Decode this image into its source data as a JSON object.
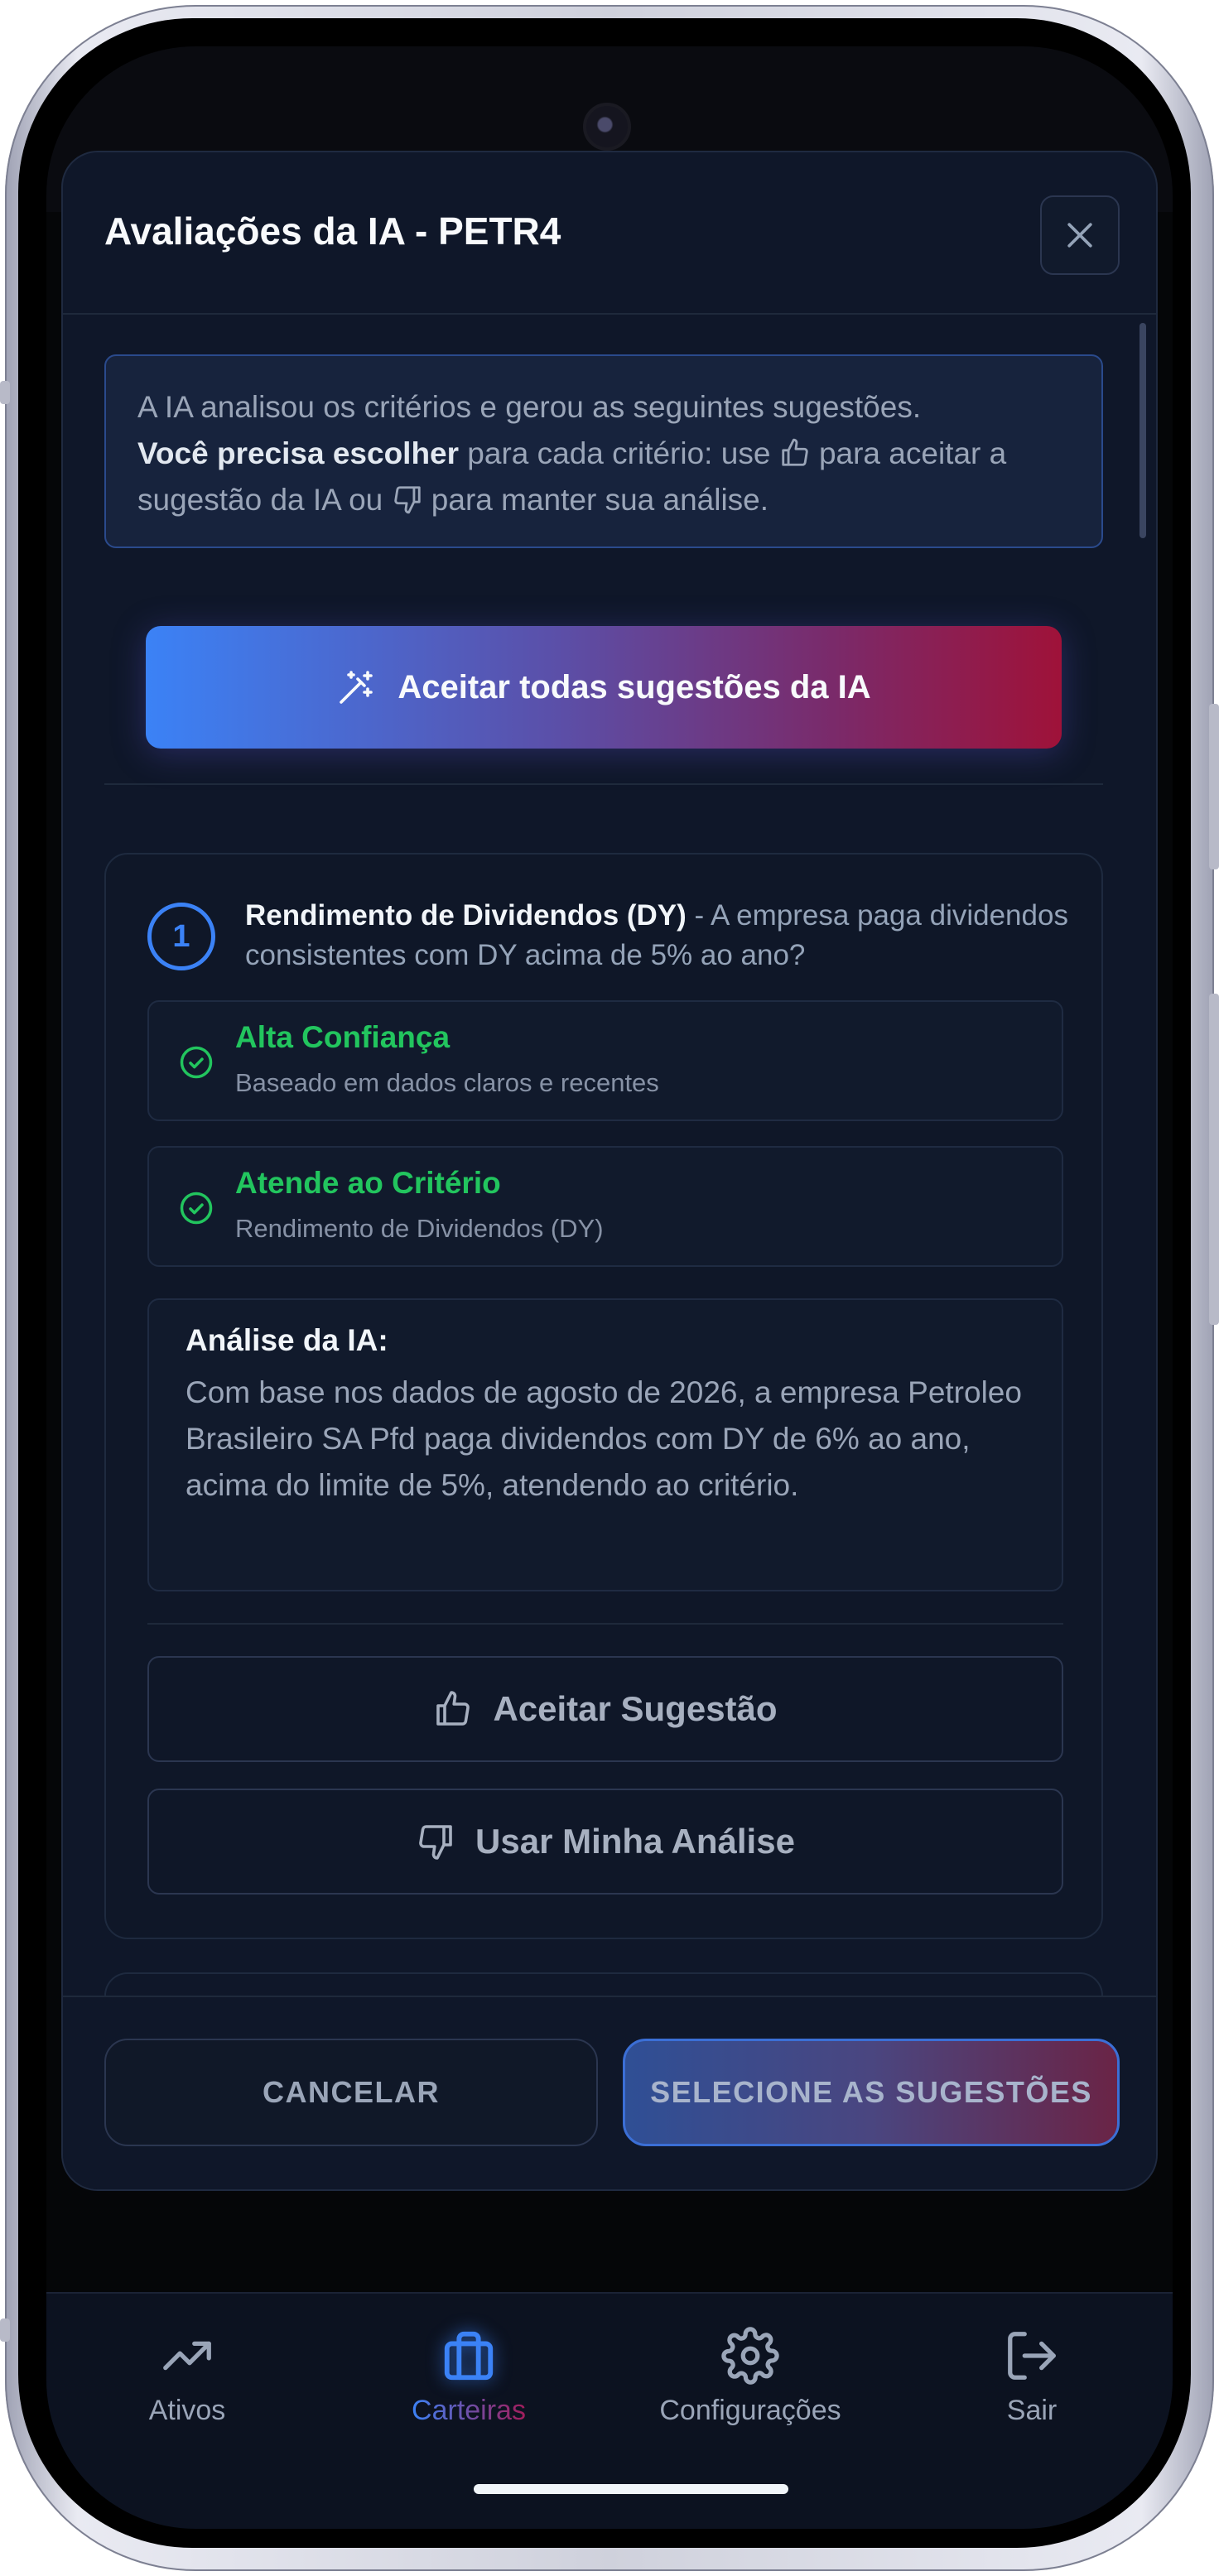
{
  "modal": {
    "title": "Avaliações da IA - PETR4",
    "close_icon": "x-icon",
    "info": {
      "line1": "A IA analisou os critérios e gerou as seguintes sugestões.",
      "bold": "Você precisa escolher",
      "part2": " para cada critério: use ",
      "part3": " para aceitar a sugestão da IA ou ",
      "part4": " para manter sua análise."
    },
    "accept_all_label": "Aceitar todas sugestões da IA",
    "criterion": {
      "number": "1",
      "name": "Rendimento de Dividendos (DY)",
      "question": " - A empresa paga dividendos consistentes com DY acima de 5% ao ano?",
      "confidence_title": "Alta Confiança",
      "confidence_sub": "Baseado em dados claros e recentes",
      "result_title": "Atende ao Critério",
      "result_sub": "Rendimento de Dividendos (DY)",
      "analysis_title": "Análise da IA:",
      "analysis_text": "Com base nos dados de agosto de 2026, a empresa Petroleo Brasileiro SA Pfd paga dividendos com DY de 6% ao ano, acima do limite de 5%, atendendo ao critério.",
      "accept_label": "Aceitar Sugestão",
      "own_label": "Usar Minha Análise"
    },
    "footer": {
      "cancel_label": "CANCELAR",
      "select_label": "SELECIONE AS SUGESTÕES"
    }
  },
  "nav": {
    "items": [
      {
        "label": "Ativos",
        "icon": "trending-up-icon"
      },
      {
        "label": "Carteiras",
        "icon": "briefcase-icon",
        "active": true
      },
      {
        "label": "Configurações",
        "icon": "gear-icon"
      },
      {
        "label": "Sair",
        "icon": "logout-icon"
      }
    ]
  },
  "colors": {
    "accent_blue": "#3b82f6",
    "accent_crimson": "#9f1239",
    "success": "#22c55e",
    "background": "#0f1729"
  }
}
